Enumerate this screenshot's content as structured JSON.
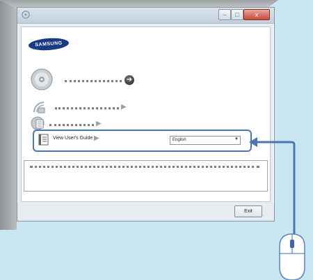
{
  "brand": {
    "logo_text": "SAMSUNG"
  },
  "rows": [
    {
      "icon": "cd-disc-icon"
    },
    {
      "icon": "wireless-setup-icon"
    },
    {
      "icon": "software-list-icon"
    }
  ],
  "guide": {
    "label": "View User's Guide",
    "language_selected": "English",
    "icon": "manual-book-icon"
  },
  "buttons": {
    "exit": "Exit"
  },
  "window_controls": {
    "minimize": "–",
    "maximize": "□",
    "close": "x"
  },
  "colors": {
    "highlight": "#4a76b5",
    "background": "#cbe6f3",
    "logo": "#1b3a86"
  }
}
